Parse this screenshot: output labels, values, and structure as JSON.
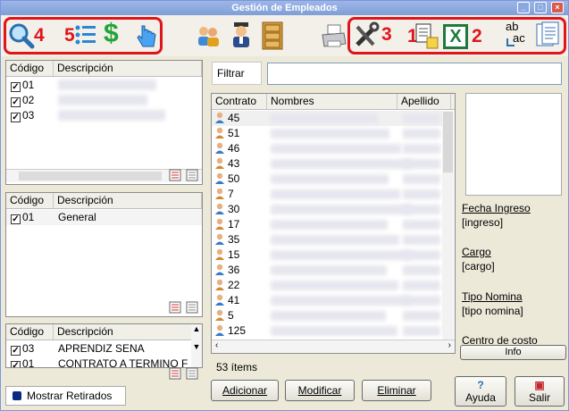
{
  "window": {
    "title": "Gestión de Empleados",
    "controls": [
      "_",
      "□",
      "×"
    ]
  },
  "toolbar": {
    "left_labels": {
      "search": "4",
      "list": "5"
    },
    "right_labels": {
      "tools": "3",
      "export": "1",
      "excel": "2"
    },
    "excel_letter": "X",
    "spell_top": "ab",
    "spell_bottom": "ac",
    "dollar": "$"
  },
  "grid1": {
    "headers": [
      "Código",
      "Descripción"
    ],
    "rows": [
      {
        "code": "01",
        "checked": true
      },
      {
        "code": "02",
        "checked": true
      },
      {
        "code": "03",
        "checked": true
      }
    ]
  },
  "grid2": {
    "headers": [
      "Código",
      "Descripción"
    ],
    "rows": [
      {
        "code": "01",
        "desc": "General",
        "checked": true
      }
    ]
  },
  "grid3": {
    "headers": [
      "Código",
      "Descripción"
    ],
    "rows": [
      {
        "code": "03",
        "desc": "APRENDIZ SENA",
        "checked": true
      },
      {
        "code": "01",
        "desc": "CONTRATO A TERMINO F",
        "checked": true
      }
    ]
  },
  "filter": {
    "label": "Filtrar",
    "value": ""
  },
  "employees": {
    "headers": [
      "Contrato",
      "Nombres",
      "Apellido"
    ],
    "contracts": [
      "45",
      "51",
      "46",
      "43",
      "50",
      "7",
      "30",
      "17",
      "35",
      "15",
      "36",
      "22",
      "41",
      "5",
      "125"
    ],
    "count_text": "53 ítems"
  },
  "details": {
    "fecha_label": "Fecha Ingreso",
    "fecha_value": "[ingreso]",
    "cargo_label": "Cargo",
    "cargo_value": "[cargo]",
    "tipo_label": "Tipo Nomina",
    "tipo_value": "[tipo nomina]",
    "centro_label": "Centro de costo",
    "info_button": "Info"
  },
  "show_retired": "Mostrar Retirados",
  "buttons": {
    "add": "Adicionar",
    "edit": "Modificar",
    "delete": "Eliminar",
    "help": "Ayuda",
    "exit": "Salir",
    "help_icon": "?"
  },
  "colors": {
    "accent_red": "#e0151c",
    "excel_green": "#1e7a3c",
    "title_blue": "#7f9fd8"
  }
}
